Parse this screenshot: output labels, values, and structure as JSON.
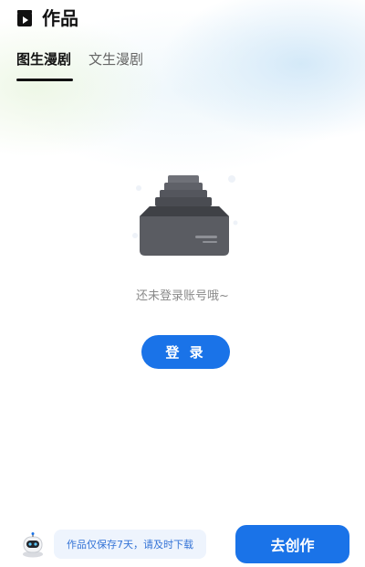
{
  "header": {
    "icon": "clapperboard-icon",
    "title": "作品"
  },
  "tabs": [
    {
      "label": "图生漫剧",
      "active": true
    },
    {
      "label": "文生漫剧",
      "active": false
    }
  ],
  "empty_state": {
    "illustration": "empty-inbox-illustration",
    "message": "还未登录账号哦~",
    "login_label": "登 录"
  },
  "footer": {
    "avatar": "robot-avatar-icon",
    "notice": "作品仅保存7天，请及时下载",
    "create_label": "去创作"
  },
  "colors": {
    "accent": "#1a73e8",
    "notice_text": "#3473d6",
    "notice_bg": "#eef4fd",
    "muted_text": "#8a8a8a"
  }
}
